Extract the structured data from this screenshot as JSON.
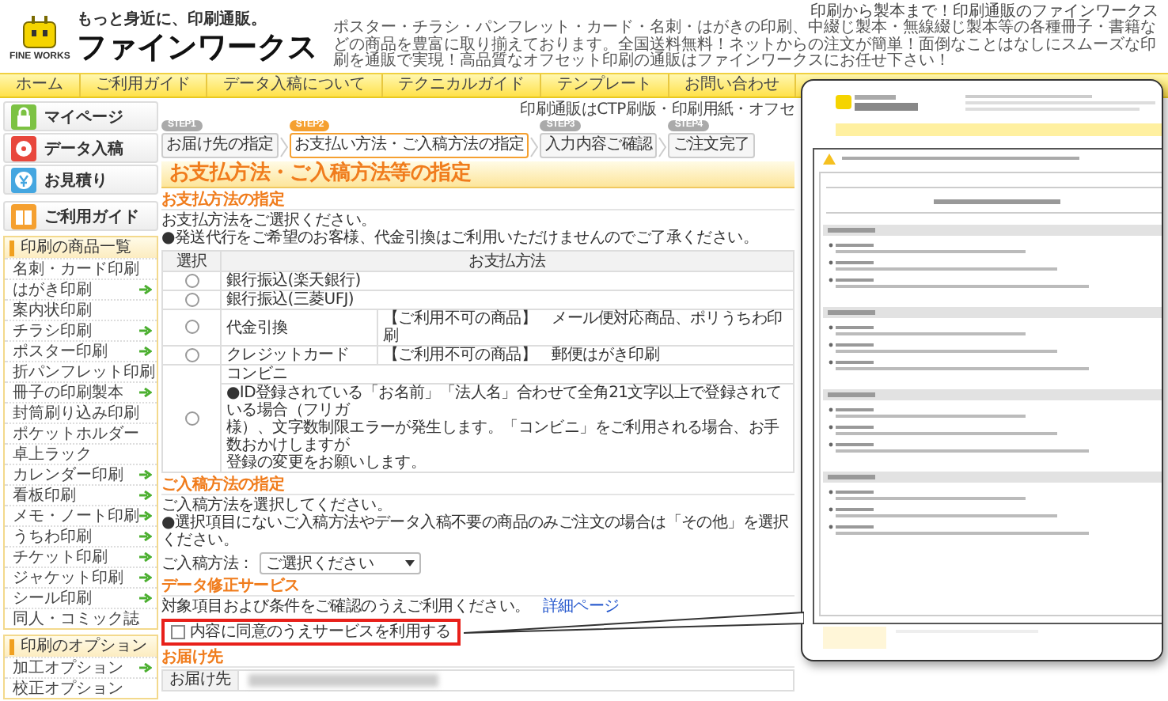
{
  "header": {
    "logo_caption": "FINE WORKS",
    "tagline": "もっと身近に、印刷通販。",
    "brand": "ファインワークス",
    "headline": "印刷から製本まで！印刷通販のファインワークス",
    "description": "ポスター・チラシ・パンフレット・カード・名刺・はがきの印刷、中綴じ製本・無線綴じ製本等の各種冊子・書籍などの商品を豊富に取り揃えております。全国送料無料！ネットからの注文が簡単！面倒なことはなしにスムーズな印刷を通販で実現！高品質なオフセット印刷の通販はファインワークスにお任せ下さい！"
  },
  "nav": [
    "ホーム",
    "ご利用ガイド",
    "データ入稿について",
    "テクニカルガイド",
    "テンプレート",
    "お問い合わせ"
  ],
  "notice": "印刷通販はCTP刷版・印刷用紙・オフセ",
  "sidebar": {
    "buttons": [
      {
        "kind": "mypage",
        "label": "マイページ"
      },
      {
        "kind": "upload",
        "label": "データ入稿"
      },
      {
        "kind": "estimate",
        "label": "お見積り"
      },
      {
        "kind": "guide",
        "label": "ご利用ガイド"
      }
    ],
    "groups": [
      {
        "title": "印刷の商品一覧",
        "items": [
          {
            "label": "名刺・カード印刷",
            "arrow": false
          },
          {
            "label": "はがき印刷",
            "arrow": true
          },
          {
            "label": "案内状印刷",
            "arrow": false
          },
          {
            "label": "チラシ印刷",
            "arrow": true
          },
          {
            "label": "ポスター印刷",
            "arrow": true
          },
          {
            "label": "折パンフレット印刷",
            "arrow": false
          },
          {
            "label": "冊子の印刷製本",
            "arrow": true
          },
          {
            "label": "封筒刷り込み印刷",
            "arrow": false
          },
          {
            "label": "ポケットホルダー",
            "arrow": false
          },
          {
            "label": "卓上ラック",
            "arrow": false
          },
          {
            "label": "カレンダー印刷",
            "arrow": true
          },
          {
            "label": "看板印刷",
            "arrow": true
          },
          {
            "label": "メモ・ノート印刷",
            "arrow": true
          },
          {
            "label": "うちわ印刷",
            "arrow": true
          },
          {
            "label": "チケット印刷",
            "arrow": true
          },
          {
            "label": "ジャケット印刷",
            "arrow": true
          },
          {
            "label": "シール印刷",
            "arrow": true
          },
          {
            "label": "同人・コミック誌",
            "arrow": false
          }
        ]
      },
      {
        "title": "印刷のオプション",
        "items": [
          {
            "label": "加工オプション",
            "arrow": true
          },
          {
            "label": "校正オプション",
            "arrow": false
          }
        ]
      }
    ]
  },
  "steps": [
    {
      "tag": "STEP1",
      "label": "お届け先の指定",
      "selected": false
    },
    {
      "tag": "STEP2",
      "label": "お支払い方法・ご入稿方法の指定",
      "selected": true
    },
    {
      "tag": "STEP3",
      "label": "入力内容ご確認",
      "selected": false
    },
    {
      "tag": "STEP4",
      "label": "ご注文完了",
      "selected": false
    }
  ],
  "page_title": "お支払方法・ご入稿方法等の指定",
  "payment": {
    "heading": "お支払方法の指定",
    "notes": [
      "お支払方法をご選択ください。",
      "●発送代行をご希望のお客様、代金引換はご利用いただけませんのでご了承ください。"
    ],
    "columns": [
      "選択",
      "お支払方法"
    ],
    "rows": [
      {
        "kind": "simple",
        "method": "銀行振込(楽天銀行)",
        "selected": false
      },
      {
        "kind": "simple",
        "method": "銀行振込(三菱UFJ)",
        "selected": false
      },
      {
        "kind": "note",
        "method": "代金引換",
        "note": "【ご利用不可の商品】　メール便対応商品、ポリうちわ印刷",
        "selected": false
      },
      {
        "kind": "note",
        "method": "クレジットカード",
        "note": "【ご利用不可の商品】　郵便はがき印刷",
        "selected": false
      },
      {
        "kind": "details",
        "method": "コンビニ",
        "details": [
          "●ID登録されている「お名前」「法人名」合わせて全角21文字以上で登録されている場合（フリガ",
          "様）、文字数制限エラーが発生します。「コンビニ」をご利用される場合、お手数おかけしますが",
          "登録の変更をお願いします。"
        ],
        "selected": false
      }
    ]
  },
  "upload": {
    "heading": "ご入稿方法の指定",
    "notes": [
      "ご入稿方法を選択してください。",
      "●選択項目にないご入稿方法やデータ入稿不要の商品のみご注文の場合は「その他」を選択ください。"
    ],
    "select_label": "ご入稿方法：",
    "select_value": "ご選択ください"
  },
  "correction": {
    "heading": "データ修正サービス",
    "text": "対象項目および条件をご確認のうえご利用ください。",
    "link": "詳細ページ",
    "checkbox": {
      "label": "内容に同意のうえサービスを利用する",
      "checked": false
    }
  },
  "delivery": {
    "heading": "お届け先",
    "label": "お届け先"
  }
}
